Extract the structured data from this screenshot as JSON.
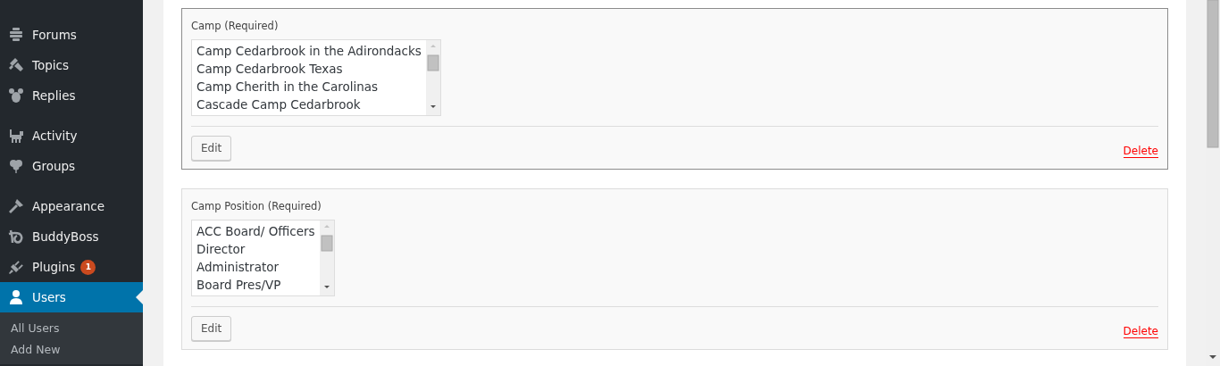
{
  "sidebar": {
    "groups": [
      {
        "items": [
          {
            "label": "Forums",
            "kind": "forums",
            "selected": false
          },
          {
            "label": "Topics",
            "kind": "topics",
            "selected": false
          },
          {
            "label": "Replies",
            "kind": "replies",
            "selected": false
          }
        ]
      },
      {
        "items": [
          {
            "label": "Activity",
            "kind": "activity",
            "selected": false
          },
          {
            "label": "Groups",
            "kind": "groups",
            "selected": false
          }
        ]
      },
      {
        "items": [
          {
            "label": "Appearance",
            "kind": "appearance",
            "selected": false
          },
          {
            "label": "BuddyBoss",
            "kind": "buddyboss",
            "selected": false
          },
          {
            "label": "Plugins",
            "kind": "plugins",
            "selected": false,
            "badge": "1"
          },
          {
            "label": "Users",
            "kind": "users",
            "selected": true,
            "submenu": [
              "All Users",
              "Add New"
            ]
          }
        ]
      }
    ]
  },
  "fields": [
    {
      "label": "Camp (Required)",
      "active": true,
      "options": [
        "Camp Cedarbrook in the Adirondacks",
        "Camp Cedarbrook Texas",
        "Camp Cherith in the Carolinas",
        "Cascade Camp Cedarbrook"
      ],
      "edit": "Edit",
      "delete": "Delete"
    },
    {
      "label": "Camp Position (Required)",
      "active": false,
      "options": [
        "ACC Board/ Officers",
        "Director",
        "Administrator",
        "Board Pres/VP"
      ],
      "edit": "Edit",
      "delete": "Delete"
    }
  ]
}
